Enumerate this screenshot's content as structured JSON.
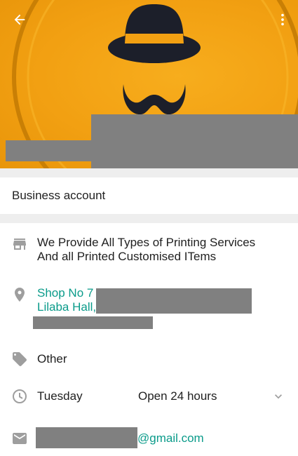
{
  "header": {
    "back_icon": "arrow-back-icon",
    "menu_icon": "more-vert-icon",
    "colors": {
      "background": "#f2a012",
      "art": "#1c1f2a"
    }
  },
  "account_type": "Business account",
  "details": {
    "description": {
      "icon": "storefront-icon",
      "line1": "We Provide All Types of Printing Services",
      "line2": "And all Printed Customised ITems"
    },
    "address": {
      "icon": "location-pin-icon",
      "line1": "Shop No 7",
      "line2": "Lilaba Hall,"
    },
    "category": {
      "icon": "tag-icon",
      "label": "Other"
    },
    "hours": {
      "icon": "clock-icon",
      "day": "Tuesday",
      "status": "Open 24 hours",
      "expand_icon": "chevron-down-icon"
    },
    "email": {
      "icon": "mail-icon",
      "domain": "@gmail.com"
    }
  },
  "colors": {
    "link": "#0a9b8a",
    "icon": "#9e9e9e",
    "divider": "#eeeeee"
  }
}
